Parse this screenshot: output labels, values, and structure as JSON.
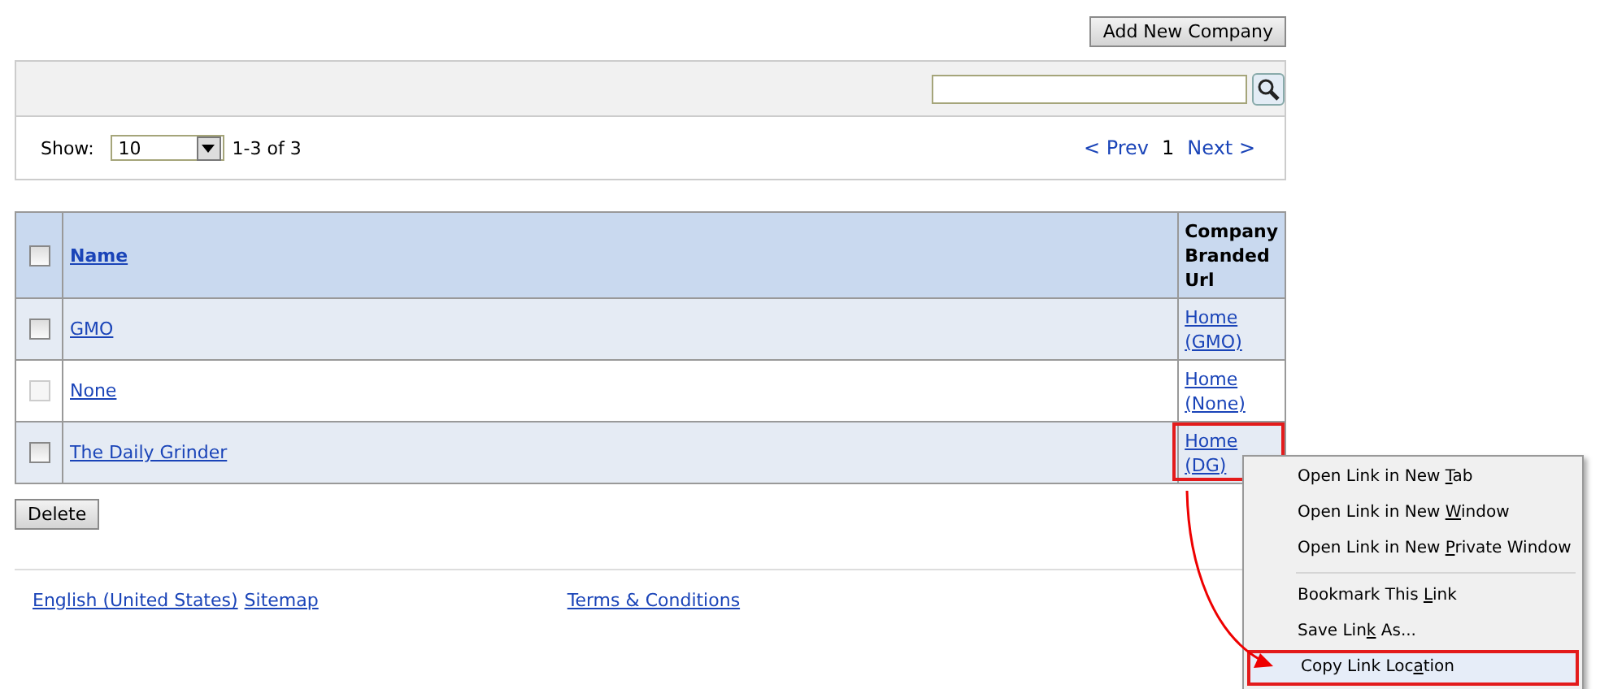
{
  "add_button": "Add New Company",
  "pager": {
    "show_label": "Show:",
    "page_size": "10",
    "range": "1-3 of 3",
    "prev": "< Prev",
    "page": "1",
    "next": "Next >"
  },
  "table": {
    "columns": [
      "Name",
      "Company Branded Url"
    ],
    "header_checked": false,
    "rows": [
      {
        "name": "GMO",
        "url": [
          "Home",
          "(GMO)"
        ],
        "checked": false,
        "disabled": false,
        "highlighted": false
      },
      {
        "name": "None",
        "url": [
          "Home",
          "(None)"
        ],
        "checked": false,
        "disabled": true,
        "highlighted": false
      },
      {
        "name": "The Daily Grinder",
        "url": [
          "Home",
          "(DG)"
        ],
        "checked": false,
        "disabled": false,
        "highlighted": true
      }
    ]
  },
  "delete_button": "Delete",
  "footer": {
    "left_links": [
      "English (United States)",
      "Sitemap"
    ],
    "center_link": "Terms & Conditions"
  },
  "context_menu": [
    {
      "before": "Open Link in New ",
      "key": "T",
      "after": "ab",
      "separator_before": false,
      "highlighted": false
    },
    {
      "before": "Open Link in New ",
      "key": "W",
      "after": "indow",
      "separator_before": false,
      "highlighted": false
    },
    {
      "before": "Open Link in New ",
      "key": "P",
      "after": "rivate Window",
      "separator_before": false,
      "highlighted": false
    },
    {
      "before": "Bookmark This ",
      "key": "L",
      "after": "ink",
      "separator_before": true,
      "highlighted": false
    },
    {
      "before": "Save Lin",
      "key": "k",
      "after": " As...",
      "separator_before": false,
      "highlighted": false
    },
    {
      "before": "Copy Link Loc",
      "key": "a",
      "after": "tion",
      "separator_before": false,
      "highlighted": true
    }
  ]
}
